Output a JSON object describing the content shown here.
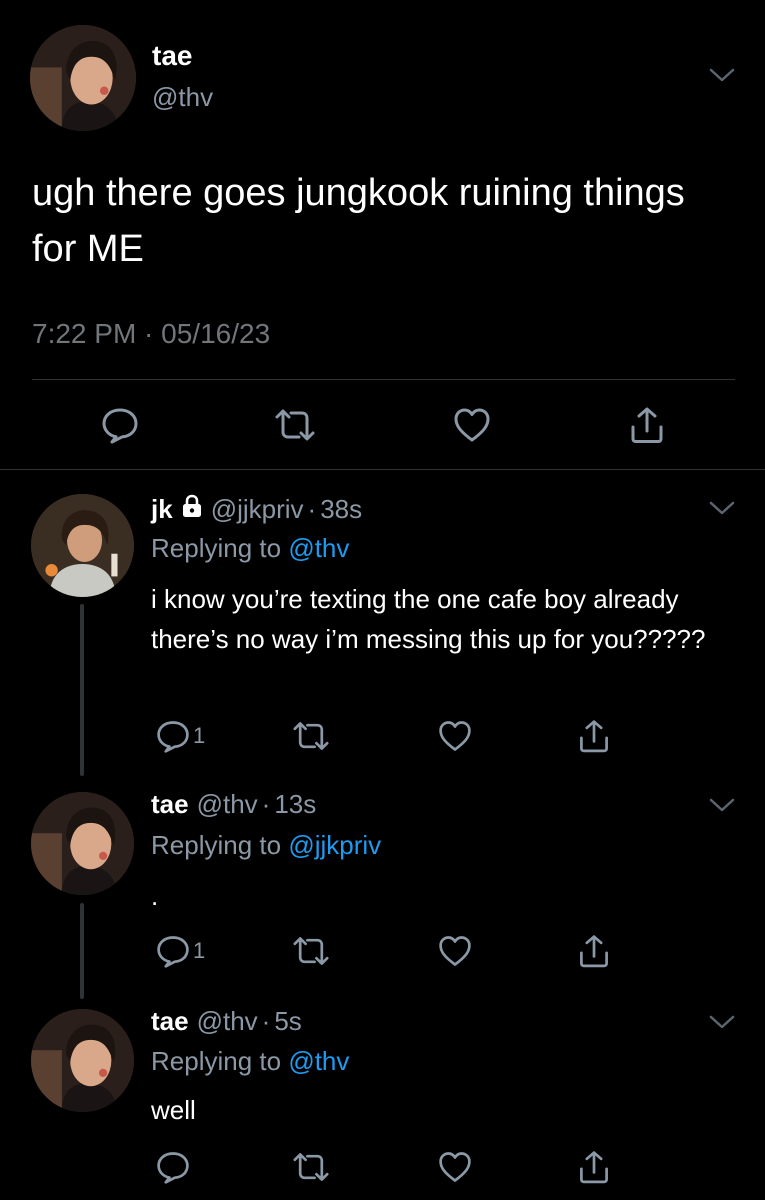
{
  "main_tweet": {
    "name": "tae",
    "handle": "@thv",
    "text": "ugh there goes jungkook ruining things for ME",
    "timestamp": "7:22 PM · 05/16/23"
  },
  "replies": [
    {
      "name": "jk",
      "locked": true,
      "handle": "@jjkpriv",
      "time": "38s",
      "replying_prefix": "Replying to",
      "replying_to": "@thv",
      "text": "i know you’re texting the one cafe boy already there’s no way i’m messing this up for you?????",
      "reply_count": "1"
    },
    {
      "name": "tae",
      "locked": false,
      "handle": "@thv",
      "time": "13s",
      "replying_prefix": "Replying to",
      "replying_to": "@jjkpriv",
      "text": ".",
      "reply_count": "1"
    },
    {
      "name": "tae",
      "locked": false,
      "handle": "@thv",
      "time": "5s",
      "replying_prefix": "Replying to",
      "replying_to": "@thv",
      "text": "well",
      "reply_count": ""
    }
  ],
  "separator": "·",
  "icons": {
    "reply": "reply-icon",
    "retweet": "retweet-icon",
    "like": "heart-icon",
    "share": "share-icon",
    "more": "chevron-down-icon",
    "lock": "lock-icon"
  },
  "colors": {
    "background": "#000000",
    "text": "#ffffff",
    "secondary": "#8b98a5",
    "link": "#1d9bf0",
    "divider": "#2f3336"
  }
}
